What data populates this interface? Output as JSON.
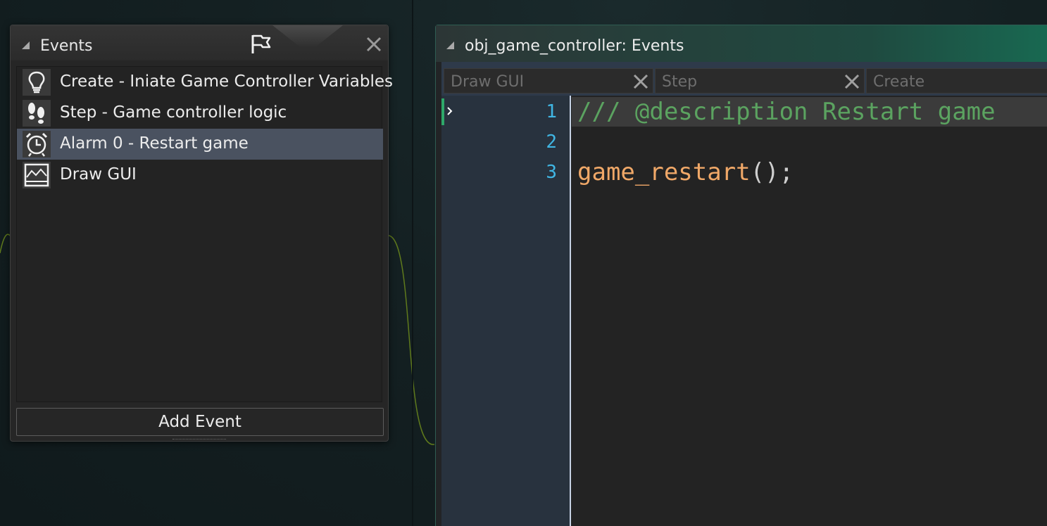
{
  "events_panel": {
    "title": "Events",
    "icons": {
      "collapse": "collapse-triangle-icon",
      "flag": "flag-icon",
      "close": "close-icon"
    },
    "items": [
      {
        "label": "Create - Iniate Game Controller Variables",
        "icon": "lightbulb-icon",
        "selected": false
      },
      {
        "label": "Step - Game controller logic",
        "icon": "footsteps-icon",
        "selected": false
      },
      {
        "label": "Alarm 0 - Restart game",
        "icon": "alarm-clock-icon",
        "selected": true
      },
      {
        "label": "Draw GUI",
        "icon": "draw-gui-icon",
        "selected": false
      }
    ],
    "add_event_label": "Add Event"
  },
  "code_panel": {
    "title": "obj_game_controller: Events",
    "tabs": [
      {
        "label": "Draw GUI",
        "closable": true
      },
      {
        "label": "Step",
        "closable": true
      },
      {
        "label": "Create",
        "closable": false
      }
    ],
    "line_numbers": [
      "1",
      "2",
      "3"
    ],
    "code": {
      "line1": "/// @description Restart game",
      "line3_func": "game_restart",
      "line3_punc": "();"
    }
  },
  "colors": {
    "selected_row": "#4a5260",
    "comment": "#5ba360",
    "function": "#f0a868",
    "line_number": "#40b6e4",
    "header_accent": "#186a52"
  }
}
